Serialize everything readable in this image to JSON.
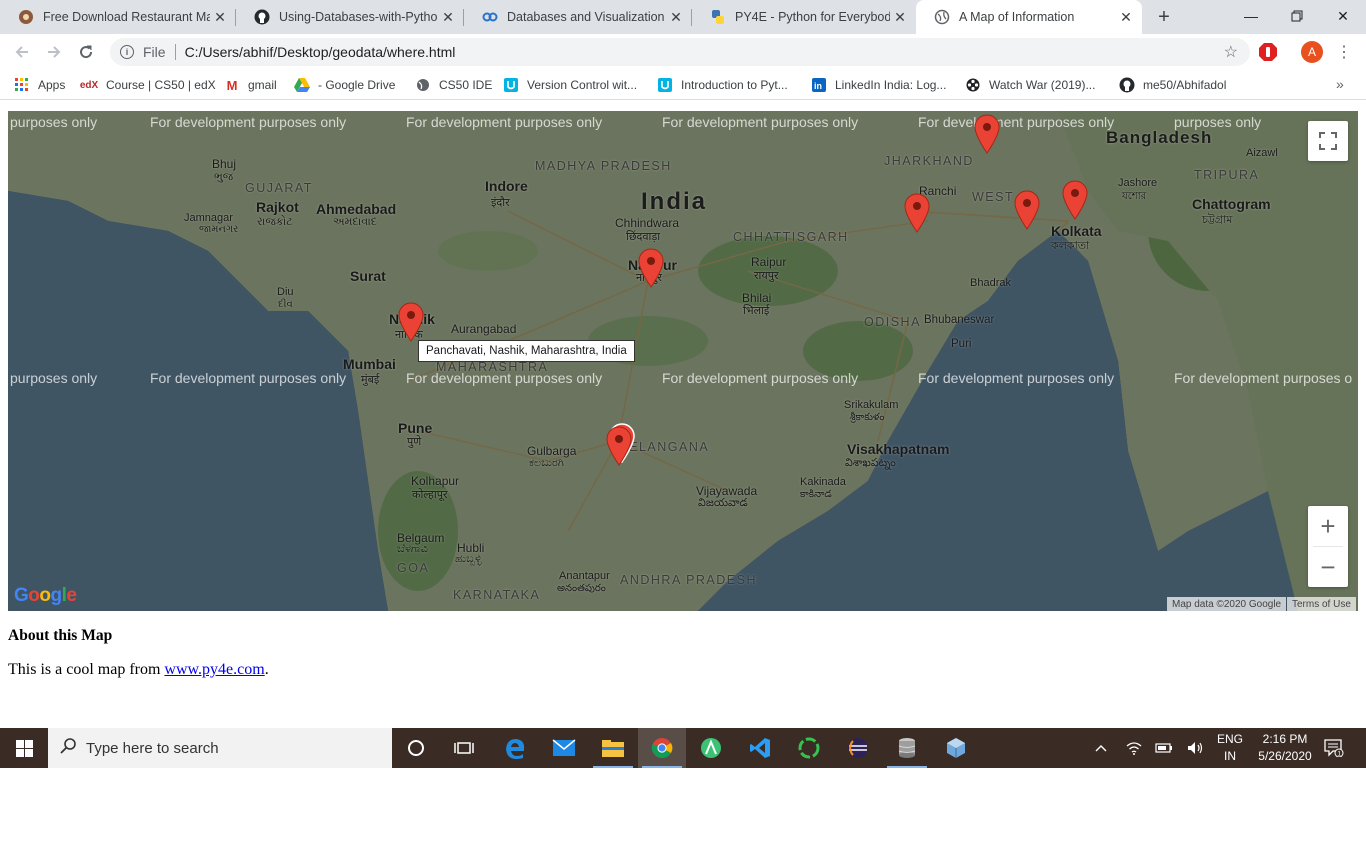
{
  "browser": {
    "tabs": [
      {
        "title": "Free Download Restaurant Ma",
        "icon": "restaurant-favicon"
      },
      {
        "title": "Using-Databases-with-Python/",
        "icon": "github-favicon"
      },
      {
        "title": "Databases and Visualization (p",
        "icon": "coursera-favicon"
      },
      {
        "title": "PY4E - Python for Everybody",
        "icon": "python-favicon"
      },
      {
        "title": "A Map of Information",
        "icon": "globe-favicon",
        "active": true
      }
    ],
    "address": {
      "scheme": "File",
      "url": "C:/Users/abhif/Desktop/geodata/where.html"
    },
    "profile_initial": "A",
    "bookmarks": [
      {
        "label": "Apps",
        "icon": "apps-grid-icon"
      },
      {
        "label": "Course | CS50 | edX",
        "icon": "edx-icon"
      },
      {
        "label": "gmail",
        "icon": "gmail-icon"
      },
      {
        "label": "- Google Drive",
        "icon": "google-drive-icon"
      },
      {
        "label": "CS50 IDE",
        "icon": "globe-icon"
      },
      {
        "label": "Version Control wit...",
        "icon": "udacity-icon"
      },
      {
        "label": "Introduction to Pyt...",
        "icon": "udacity-icon"
      },
      {
        "label": "LinkedIn India: Log...",
        "icon": "linkedin-icon"
      },
      {
        "label": "Watch War (2019)...",
        "icon": "film-reel-icon"
      },
      {
        "label": "me50/Abhifadol",
        "icon": "github-icon"
      }
    ]
  },
  "map": {
    "watermark": "For development purposes only",
    "watermark_edge": "purposes only",
    "watermark_clip": "For development purposes o",
    "country_label": "India",
    "neighbor_label": "Bangladesh",
    "regions": [
      "MADHYA PRADESH",
      "GUJARAT",
      "JHARKHAND",
      "WEST",
      "TRIPURA",
      "CHHATTISGARH",
      "ODISHA",
      "MAHARASHTRA",
      "TELANGANA",
      "ANDHRA PRADESH",
      "KARNATAKA",
      "GOA"
    ],
    "cities": [
      {
        "name": "Indore",
        "local": "इंदौर"
      },
      {
        "name": "Bhuj",
        "local": "ભુજ"
      },
      {
        "name": "Rajkot",
        "local": "રાજકોટ"
      },
      {
        "name": "Ahmedabad",
        "local": "અમદાવાદ"
      },
      {
        "name": "Jamnagar",
        "local": "જામનગર"
      },
      {
        "name": "Surat",
        "local": ""
      },
      {
        "name": "Diu",
        "local": "દીવ"
      },
      {
        "name": "Chhindwara",
        "local": "छिंदवाड़ा"
      },
      {
        "name": "Nagpur",
        "local": "नागपुर"
      },
      {
        "name": "Raipur",
        "local": "रायपुर"
      },
      {
        "name": "Bhilai",
        "local": "भिलाई"
      },
      {
        "name": "Ranchi",
        "local": ""
      },
      {
        "name": "Kolkata",
        "local": "কলকাতা"
      },
      {
        "name": "Jashore",
        "local": "যশোর"
      },
      {
        "name": "Chattogram",
        "local": "চট্টগ্রাম"
      },
      {
        "name": "Aizawl",
        "local": ""
      },
      {
        "name": "Bhadrak",
        "local": ""
      },
      {
        "name": "Bhubaneswar",
        "local": ""
      },
      {
        "name": "Puri",
        "local": ""
      },
      {
        "name": "Nashik",
        "local": "नाशिक"
      },
      {
        "name": "Aurangabad",
        "local": ""
      },
      {
        "name": "Mumbai",
        "local": "मुंबई"
      },
      {
        "name": "Pune",
        "local": "पुणे"
      },
      {
        "name": "Srikakulam",
        "local": "శ్రీకాకుళం"
      },
      {
        "name": "Visakhapatnam",
        "local": "విశాఖపట్నం"
      },
      {
        "name": "Gulbarga",
        "local": "ಕಲಬುರಗಿ"
      },
      {
        "name": "Kolhapur",
        "local": "कोल्हापूर"
      },
      {
        "name": "Vijayawada",
        "local": "విజయవాడ"
      },
      {
        "name": "Kakinada",
        "local": "కాకినాడ"
      },
      {
        "name": "Belgaum",
        "local": "ಬೆಳಗಾವಿ"
      },
      {
        "name": "Hubli",
        "local": "ಹುಬ್ಬಳ್ಳಿ"
      },
      {
        "name": "Anantapur",
        "local": "అనంతపురం"
      }
    ],
    "tooltip": "Panchavati, Nashik, Maharashtra, India",
    "attribution": "Map data ©2020 Google",
    "terms": "Terms of Use",
    "google_logo": "Google",
    "marker_color": "#ea4335"
  },
  "page": {
    "heading": "About this Map",
    "text_before": "This is a cool map from ",
    "link_text": "www.py4e.com",
    "text_after": "."
  },
  "taskbar": {
    "search_placeholder": "Type here to search",
    "lang_line1": "ENG",
    "lang_line2": "IN",
    "time": "2:16 PM",
    "date": "5/26/2020",
    "notification_count": "1",
    "apps": [
      "cortana-icon",
      "task-view-icon",
      "edge-icon",
      "mail-icon",
      "file-explorer-icon",
      "chrome-icon",
      "android-studio-icon",
      "vscode-icon",
      "spotify-like-icon",
      "eclipse-icon",
      "database-icon",
      "virtualbox-icon"
    ]
  }
}
